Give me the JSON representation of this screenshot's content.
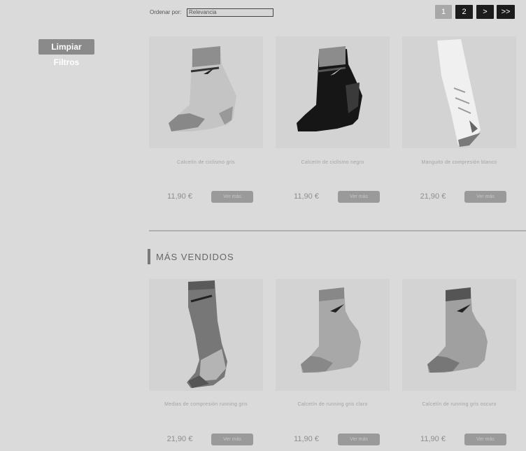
{
  "filters": {
    "clear_label": "Limpiar Filtros"
  },
  "sort": {
    "label": "Ordenar por:",
    "value": "Relevancia"
  },
  "pagination": [
    "1",
    "2",
    ">",
    ">>"
  ],
  "products_top": [
    {
      "name": "Calcetín de ciclismo gris",
      "price": "11,90 €",
      "button": "Ver más"
    },
    {
      "name": "Calcetín de ciclismo negro",
      "price": "11,90 €",
      "button": "Ver más"
    },
    {
      "name": "Manguito de compresión blanco",
      "price": "21,90 €",
      "button": "Ver más"
    }
  ],
  "section": {
    "title": "MÁS VENDIDOS"
  },
  "products_bottom": [
    {
      "name": "Medias de compresión running gris",
      "price": "21,90 €",
      "button": "Ver más"
    },
    {
      "name": "Calcetín de running gris claro",
      "price": "11,90 €",
      "button": "Ver más"
    },
    {
      "name": "Calcetín de running gris oscuro",
      "price": "11,90 €",
      "button": "Ver más"
    }
  ]
}
